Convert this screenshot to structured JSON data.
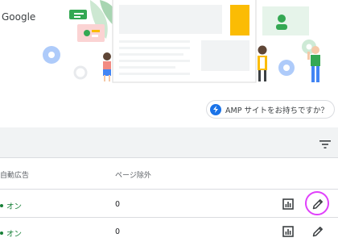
{
  "brand": {
    "label": "Google"
  },
  "amp_prompt": {
    "label": "AMP サイトをお持ちですか？"
  },
  "table": {
    "headers": [
      "自動広告",
      "ページ除外"
    ],
    "rows": [
      {
        "auto_ads": "オン",
        "page_exclusions": "0"
      },
      {
        "auto_ads": "オン",
        "page_exclusions": "0"
      }
    ]
  },
  "icons": {
    "filter": "filter-icon",
    "report": "bar-chart-icon",
    "edit": "pencil-icon",
    "amp": "lightning-icon"
  },
  "colors": {
    "status_on": "#188038",
    "accent_blue": "#1a73e8",
    "highlight": "#e040fb",
    "band": "#f1f3f4"
  }
}
